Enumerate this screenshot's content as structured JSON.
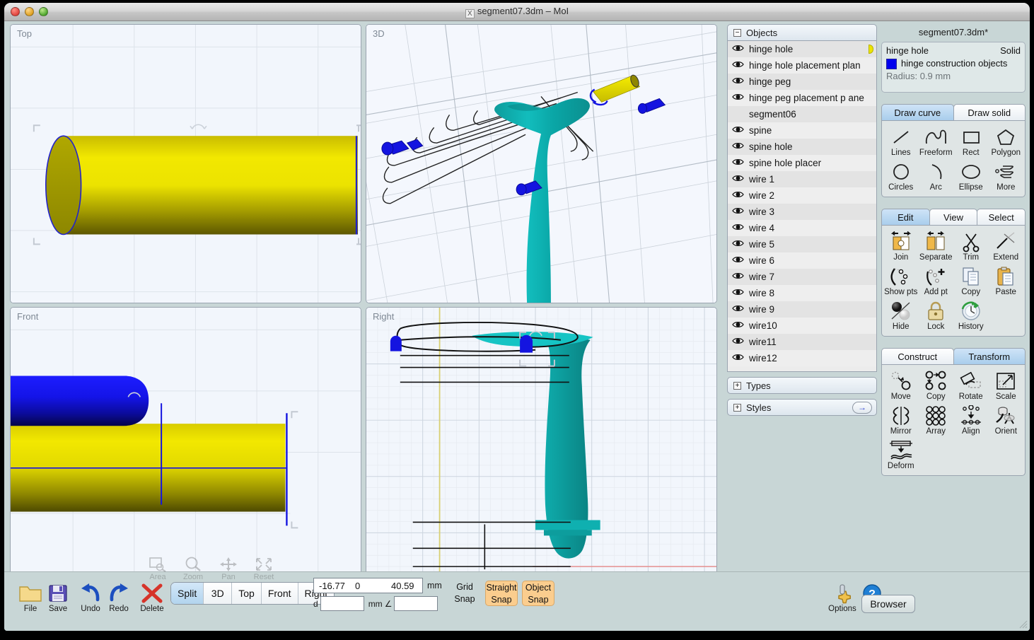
{
  "window": {
    "title": "segment07.3dm – MoI",
    "title_icon": "X"
  },
  "viewports": [
    {
      "label": "Top"
    },
    {
      "label": "3D"
    },
    {
      "label": "Front"
    },
    {
      "label": "Right"
    }
  ],
  "viewport_nav": [
    {
      "label": "Area",
      "icon": "area-icon"
    },
    {
      "label": "Zoom",
      "icon": "zoom-icon"
    },
    {
      "label": "Pan",
      "icon": "pan-icon"
    },
    {
      "label": "Reset",
      "icon": "reset-icon"
    }
  ],
  "browser": {
    "header": "Objects",
    "header_toggle": "−",
    "objects": [
      {
        "name": "hinge hole",
        "visible": true,
        "selected": true
      },
      {
        "name": "hinge hole placement plan",
        "visible": true,
        "selected": false
      },
      {
        "name": "hinge peg",
        "visible": true,
        "selected": false
      },
      {
        "name": "hinge peg placement p ane",
        "visible": true,
        "selected": false
      },
      {
        "name": "segment06",
        "visible": false,
        "selected": false
      },
      {
        "name": "spine",
        "visible": true,
        "selected": false
      },
      {
        "name": "spine hole",
        "visible": true,
        "selected": false
      },
      {
        "name": "spine hole placer",
        "visible": true,
        "selected": false
      },
      {
        "name": "wire 1",
        "visible": true,
        "selected": false
      },
      {
        "name": "wire 2",
        "visible": true,
        "selected": false
      },
      {
        "name": "wire 3",
        "visible": true,
        "selected": false
      },
      {
        "name": "wire 4",
        "visible": true,
        "selected": false
      },
      {
        "name": "wire 5",
        "visible": true,
        "selected": false
      },
      {
        "name": "wire 6",
        "visible": true,
        "selected": false
      },
      {
        "name": "wire 7",
        "visible": true,
        "selected": false
      },
      {
        "name": "wire 8",
        "visible": true,
        "selected": false
      },
      {
        "name": "wire 9",
        "visible": true,
        "selected": false
      },
      {
        "name": "wire10",
        "visible": true,
        "selected": false
      },
      {
        "name": "wire11",
        "visible": true,
        "selected": false
      },
      {
        "name": "wire12",
        "visible": true,
        "selected": false
      }
    ],
    "sections": [
      {
        "label": "Types",
        "toggle": "+",
        "has_arrow": false
      },
      {
        "label": "Styles",
        "toggle": "+",
        "has_arrow": true,
        "arrow": "→"
      }
    ]
  },
  "sidebar": {
    "document_title": "segment07.3dm*",
    "properties": {
      "object_name": "hinge hole",
      "object_type": "Solid",
      "style_name": "hinge construction objects",
      "style_color": "#0000ee",
      "dimension": "Radius: 0.9 mm"
    },
    "draw_tabs": [
      {
        "label": "Draw curve",
        "active": true
      },
      {
        "label": "Draw solid",
        "active": false
      }
    ],
    "draw_tools": [
      {
        "label": "Lines",
        "icon": "line-icon"
      },
      {
        "label": "Freeform",
        "icon": "freeform-curve-icon"
      },
      {
        "label": "Rect",
        "icon": "rectangle-icon"
      },
      {
        "label": "Polygon",
        "icon": "polygon-icon"
      },
      {
        "label": "Circles",
        "icon": "circle-icon"
      },
      {
        "label": "Arc",
        "icon": "arc-icon"
      },
      {
        "label": "Ellipse",
        "icon": "ellipse-icon"
      },
      {
        "label": "More",
        "icon": "helix-more-icon"
      }
    ],
    "edit_tabs": [
      {
        "label": "Edit",
        "active": true
      },
      {
        "label": "View",
        "active": false
      },
      {
        "label": "Select",
        "active": false
      }
    ],
    "edit_tools": [
      {
        "label": "Join",
        "icon": "join-icon"
      },
      {
        "label": "Separate",
        "icon": "separate-icon"
      },
      {
        "label": "Trim",
        "icon": "scissors-icon"
      },
      {
        "label": "Extend",
        "icon": "extend-icon"
      },
      {
        "label": "Show pts",
        "icon": "show-points-icon"
      },
      {
        "label": "Add pt",
        "icon": "add-point-icon"
      },
      {
        "label": "Copy",
        "icon": "copy-icon"
      },
      {
        "label": "Paste",
        "icon": "paste-icon"
      },
      {
        "label": "Hide",
        "icon": "hide-sphere-icon"
      },
      {
        "label": "Lock",
        "icon": "padlock-icon"
      },
      {
        "label": "History",
        "icon": "history-clock-icon"
      }
    ],
    "construct_tabs": [
      {
        "label": "Construct",
        "active": false
      },
      {
        "label": "Transform",
        "active": true
      }
    ],
    "transform_tools": [
      {
        "label": "Move",
        "icon": "move-icon"
      },
      {
        "label": "Copy",
        "icon": "copy-transform-icon"
      },
      {
        "label": "Rotate",
        "icon": "rotate-icon"
      },
      {
        "label": "Scale",
        "icon": "scale-icon"
      },
      {
        "label": "Mirror",
        "icon": "mirror-icon"
      },
      {
        "label": "Array",
        "icon": "array-icon"
      },
      {
        "label": "Align",
        "icon": "align-icon"
      },
      {
        "label": "Orient",
        "icon": "orient-icon"
      },
      {
        "label": "Deform",
        "icon": "deform-icon"
      }
    ]
  },
  "bottom": {
    "file_tools": [
      {
        "label": "File",
        "icon": "folder-icon"
      },
      {
        "label": "Save",
        "icon": "floppy-disk-icon"
      },
      {
        "label": "Undo",
        "icon": "undo-arrow-icon"
      },
      {
        "label": "Redo",
        "icon": "redo-arrow-icon"
      },
      {
        "label": "Delete",
        "icon": "delete-x-icon"
      }
    ],
    "view_buttons": [
      {
        "label": "Split",
        "active": true
      },
      {
        "label": "3D",
        "active": false
      },
      {
        "label": "Top",
        "active": false
      },
      {
        "label": "Front",
        "active": false
      },
      {
        "label": "Right",
        "active": false
      }
    ],
    "coordinates": {
      "x": "-16.77",
      "y": "0",
      "z": "40.59",
      "unit": "mm",
      "distance_label": "d",
      "distance_value": "",
      "distance_unit": "mm",
      "angle_symbol": "∠",
      "angle_value": ""
    },
    "snaps": [
      {
        "label": "Grid\nSnap",
        "line1": "Grid",
        "line2": "Snap",
        "active": false
      },
      {
        "label": "Straight Snap",
        "line1": "Straight",
        "line2": "Snap",
        "active": true
      },
      {
        "label": "Object Snap",
        "line1": "Object",
        "line2": "Snap",
        "active": true
      }
    ],
    "right_tools": [
      {
        "label": "Options",
        "icon": "gear-options-icon"
      },
      {
        "label": "Help",
        "icon": "help-question-icon"
      }
    ],
    "browser_button": "Browser"
  }
}
